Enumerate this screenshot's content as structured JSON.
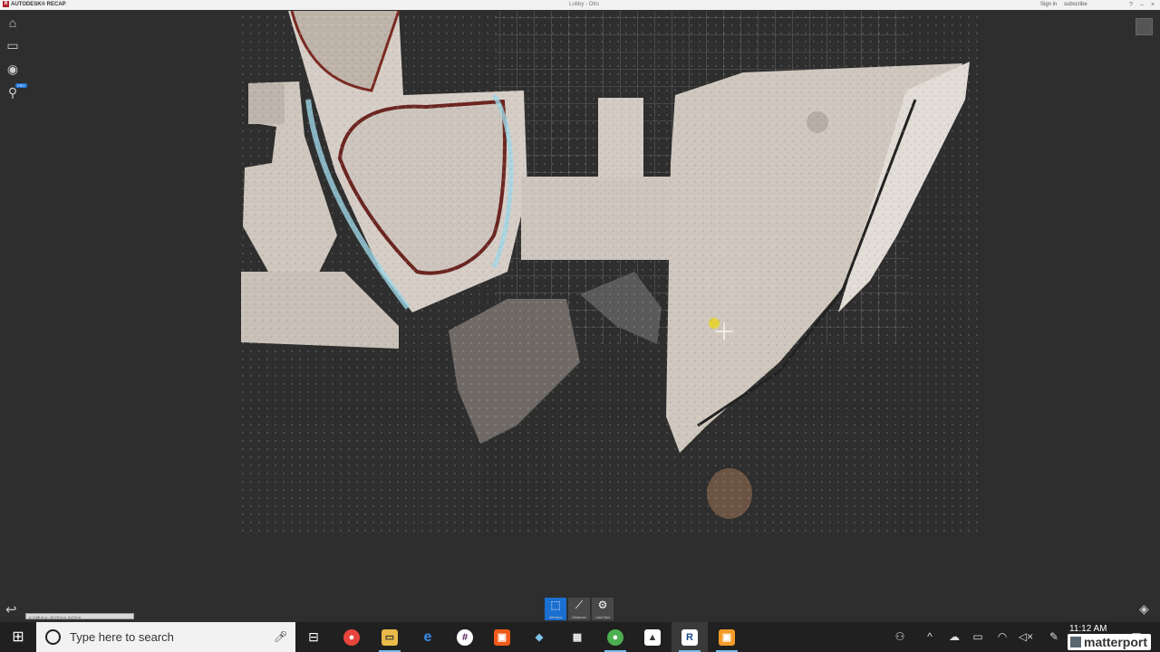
{
  "app": {
    "brand": "AUTODESK® RECAP",
    "document_title": "Lobby - Otto",
    "sign_in": "Sign in",
    "subscribe": "subscribe"
  },
  "left_toolbar": {
    "home_icon": "home-icon",
    "display_icon": "monitor-icon",
    "navigate_icon": "navigation-wheel-icon",
    "search_icon": "search-icon",
    "pro_badge": "PRO"
  },
  "scale_bar": {
    "text": "x: 0.86 m   y: -10.70 m   z: 3.470 m"
  },
  "measure_tools": [
    {
      "label": "Window",
      "icon": "window-select-icon",
      "active": true
    },
    {
      "label": "Distance",
      "icon": "distance-measure-icon",
      "active": false
    },
    {
      "label": "Limit Box",
      "icon": "limit-box-icon",
      "active": false
    }
  ],
  "taskbar": {
    "search_placeholder": "Type here to search",
    "apps": [
      {
        "name": "task-view-icon",
        "glyph": "⊟"
      },
      {
        "name": "chrome-icon",
        "glyph": "●"
      },
      {
        "name": "file-explorer-icon",
        "glyph": "▭"
      },
      {
        "name": "edge-icon",
        "glyph": "e"
      },
      {
        "name": "slack-icon",
        "glyph": "#"
      },
      {
        "name": "orange-app-icon",
        "glyph": "▣"
      },
      {
        "name": "sketch-app-icon",
        "glyph": "◆"
      },
      {
        "name": "calculator-icon",
        "glyph": "▦"
      },
      {
        "name": "chrome-profile-icon",
        "glyph": "●"
      },
      {
        "name": "photos-icon",
        "glyph": "▲"
      },
      {
        "name": "recap-taskbar-icon",
        "glyph": "R"
      },
      {
        "name": "orange-app-2-icon",
        "glyph": "▣"
      }
    ],
    "clock": "11:12 AM"
  },
  "watermark": "matterport",
  "colors": {
    "viewport_bg": "#2e2e2e",
    "accent": "#1a6fd0",
    "taskbar_bg": "#202020",
    "recap_red": "#b1272d"
  }
}
